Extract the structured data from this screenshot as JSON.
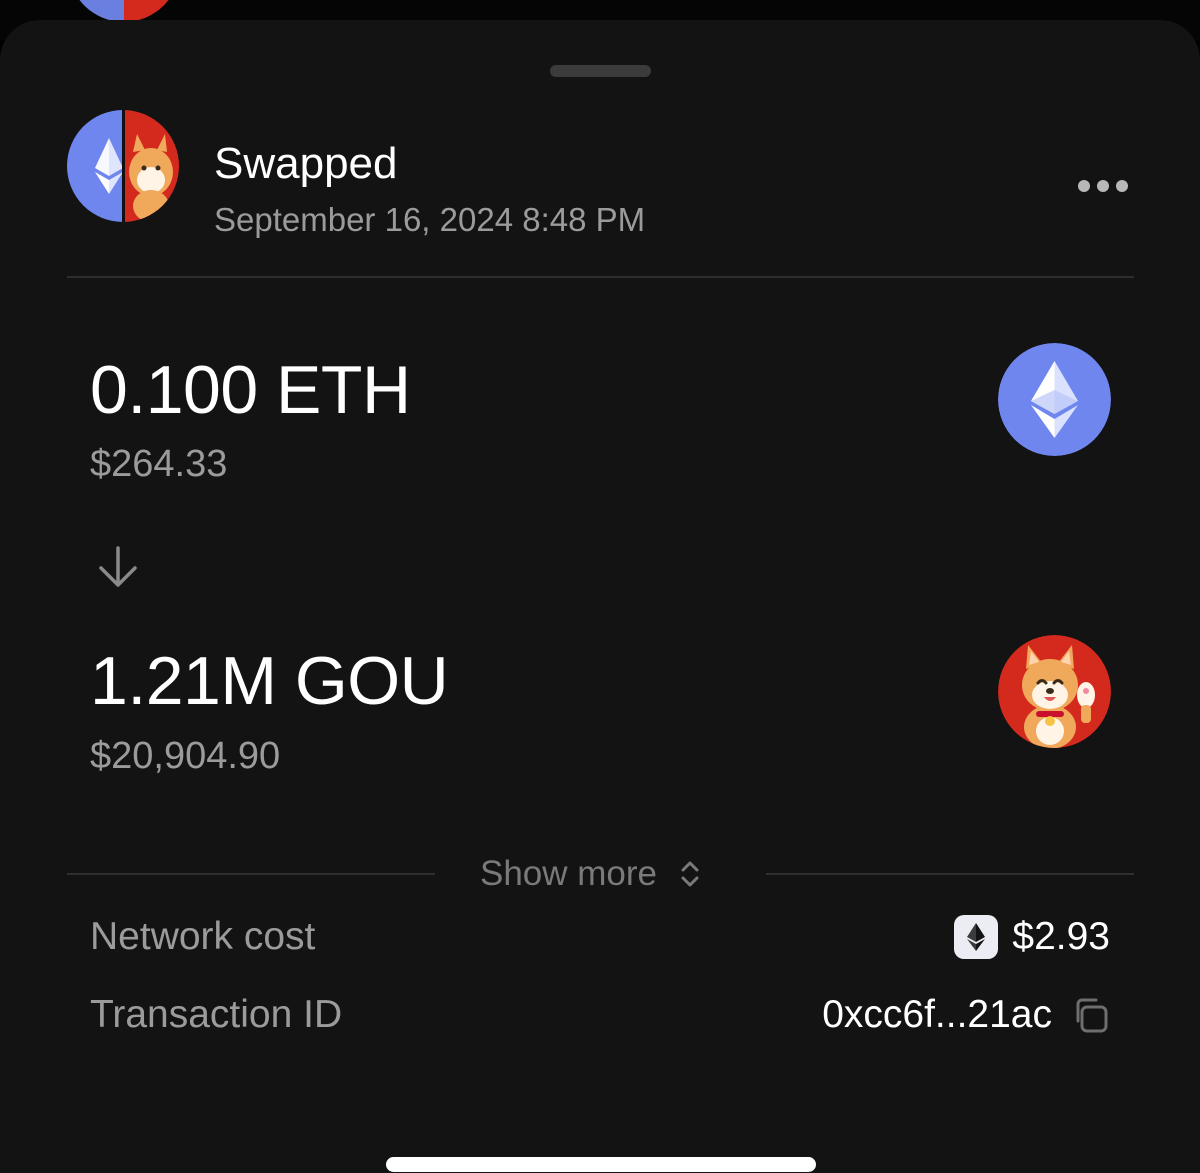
{
  "header": {
    "title": "Swapped",
    "timestamp": "September 16, 2024 8:48 PM",
    "avatar_icon": "eth-gou-swap-icon",
    "more_icon": "more-horizontal-icon"
  },
  "swap": {
    "from": {
      "amount": "0.100 ETH",
      "usd_value": "$264.33",
      "icon": "ethereum-icon",
      "color": "#6f86ee"
    },
    "direction_icon": "arrow-down-icon",
    "to": {
      "amount": "1.21M GOU",
      "usd_value": "$20,904.90",
      "icon": "gou-shiba-icon",
      "color": "#d42a1e"
    }
  },
  "show_more": {
    "label": "Show more",
    "icon": "chevron-up-down-icon"
  },
  "details": {
    "network_cost": {
      "label": "Network cost",
      "value": "$2.93",
      "icon": "ethereum-icon"
    },
    "transaction_id": {
      "label": "Transaction ID",
      "value": "0xcc6f...21ac",
      "icon": "copy-icon"
    }
  },
  "colors": {
    "sheet_bg": "#131313",
    "primary_text": "#ffffff",
    "secondary_text": "#9b9b9b",
    "divider": "#2e2e2e"
  }
}
